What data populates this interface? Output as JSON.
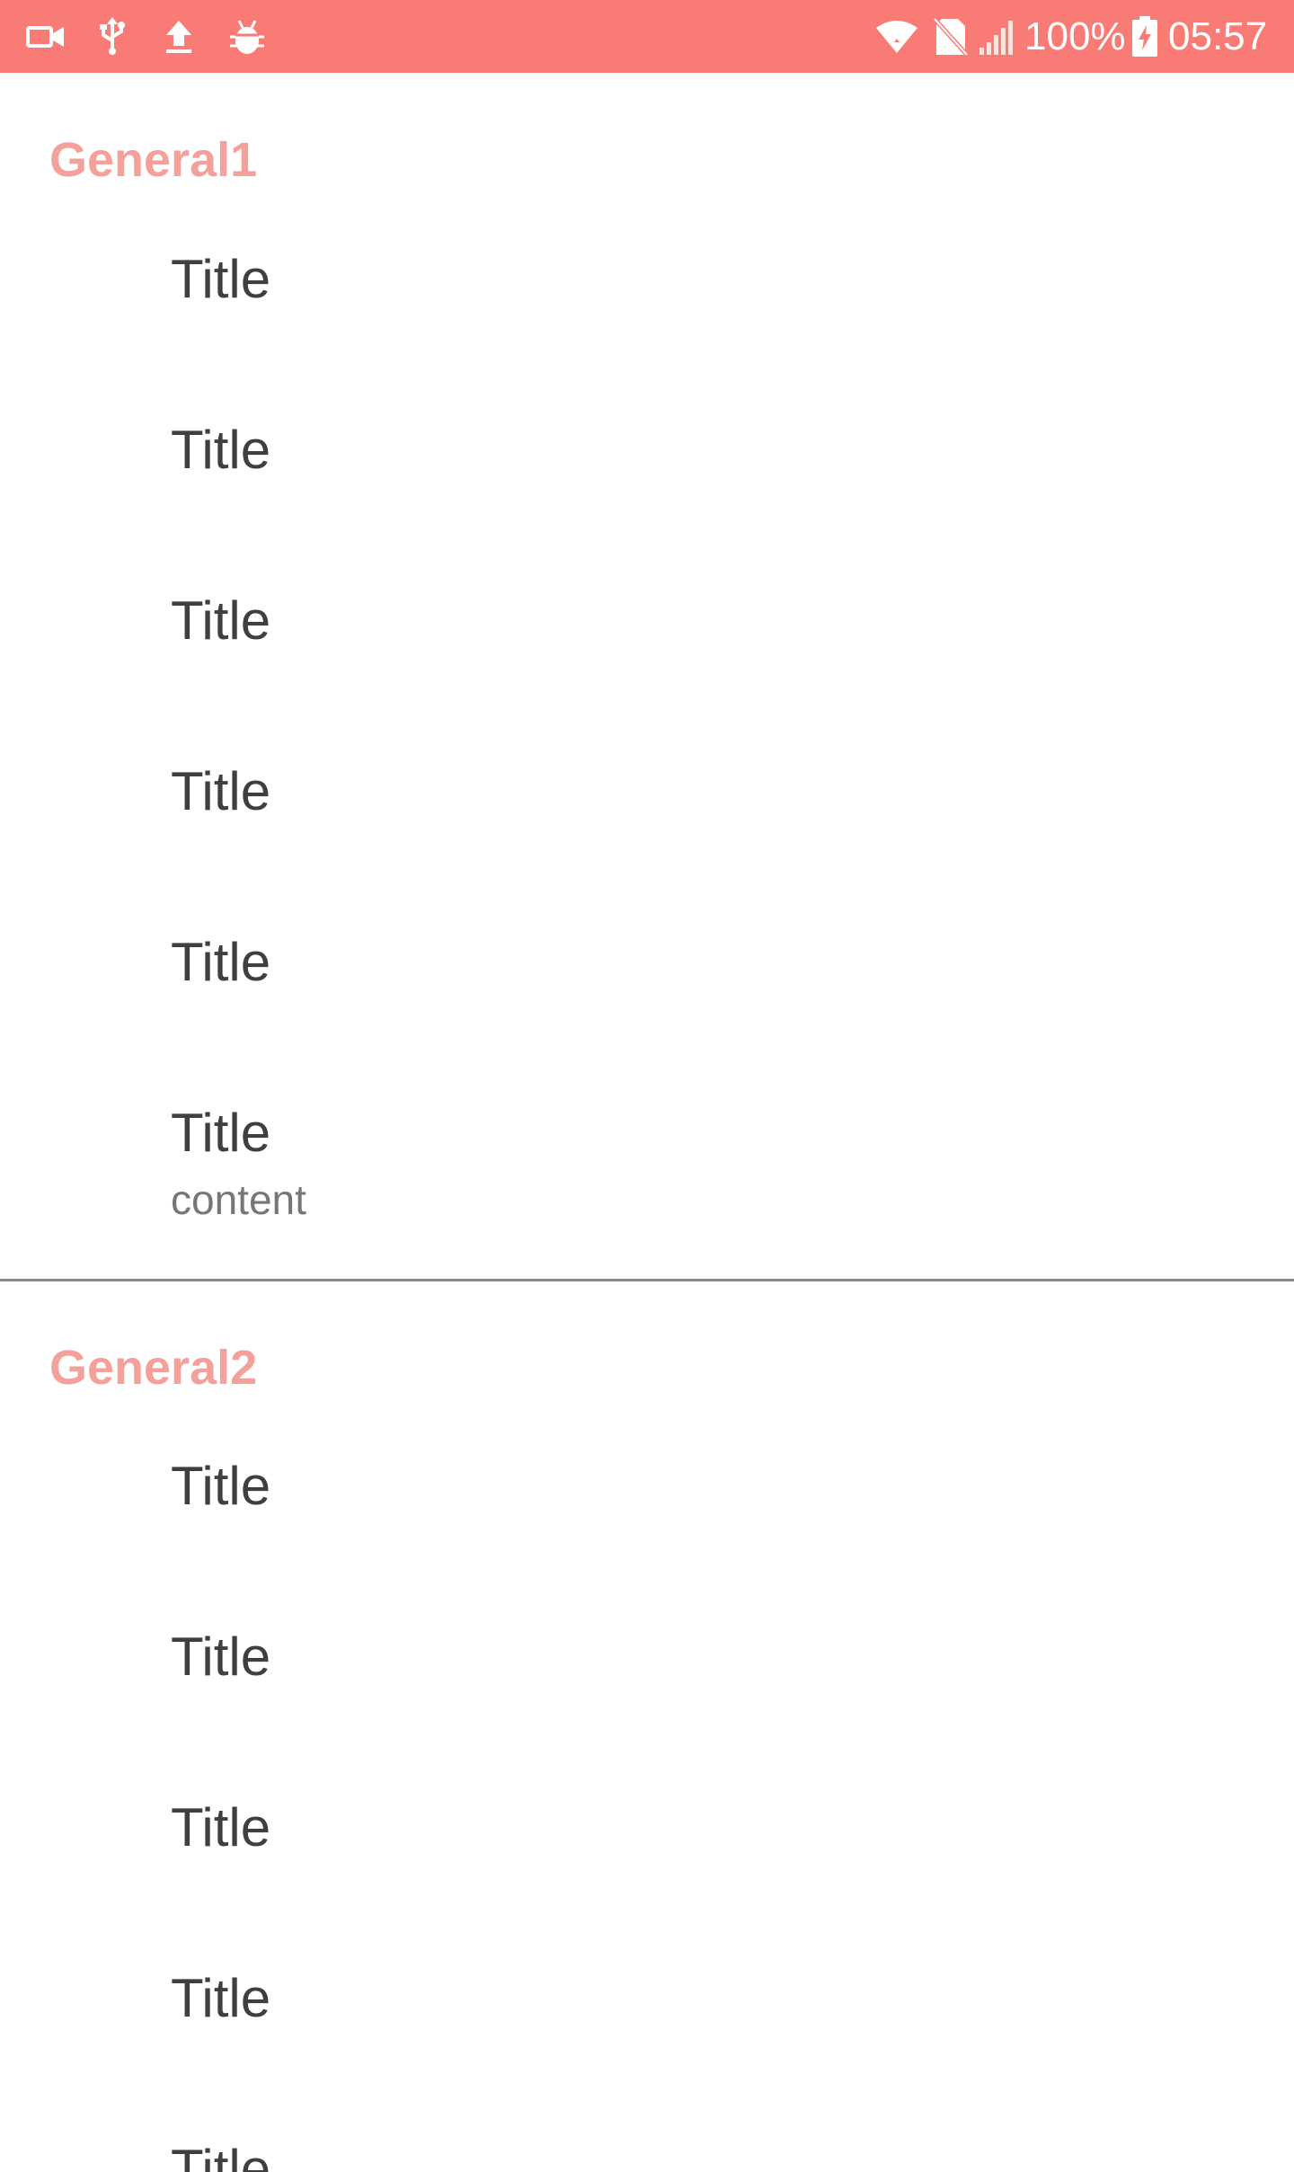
{
  "status_bar": {
    "left_icons": [
      "video-camera-icon",
      "usb-icon",
      "upload-icon",
      "android-debug-icon"
    ],
    "right_icons": [
      "wifi-icon",
      "no-sim-icon",
      "cell-signal-icon",
      "battery-charging-icon"
    ],
    "battery_percent": "100%",
    "time": "05:57",
    "background_color": "#f97b76"
  },
  "sections": [
    {
      "title": "General1",
      "items": [
        {
          "title": "Title"
        },
        {
          "title": "Title"
        },
        {
          "title": "Title"
        },
        {
          "title": "Title"
        },
        {
          "title": "Title"
        },
        {
          "title": "Title",
          "summary": "content"
        }
      ]
    },
    {
      "title": "General2",
      "items": [
        {
          "title": "Title"
        },
        {
          "title": "Title"
        },
        {
          "title": "Title"
        },
        {
          "title": "Title"
        },
        {
          "title": "Title"
        }
      ]
    }
  ],
  "colors": {
    "category_text": "#f4a09b",
    "item_title": "#3f3f3f",
    "item_summary": "#767676",
    "divider": "#8a8a8a"
  }
}
